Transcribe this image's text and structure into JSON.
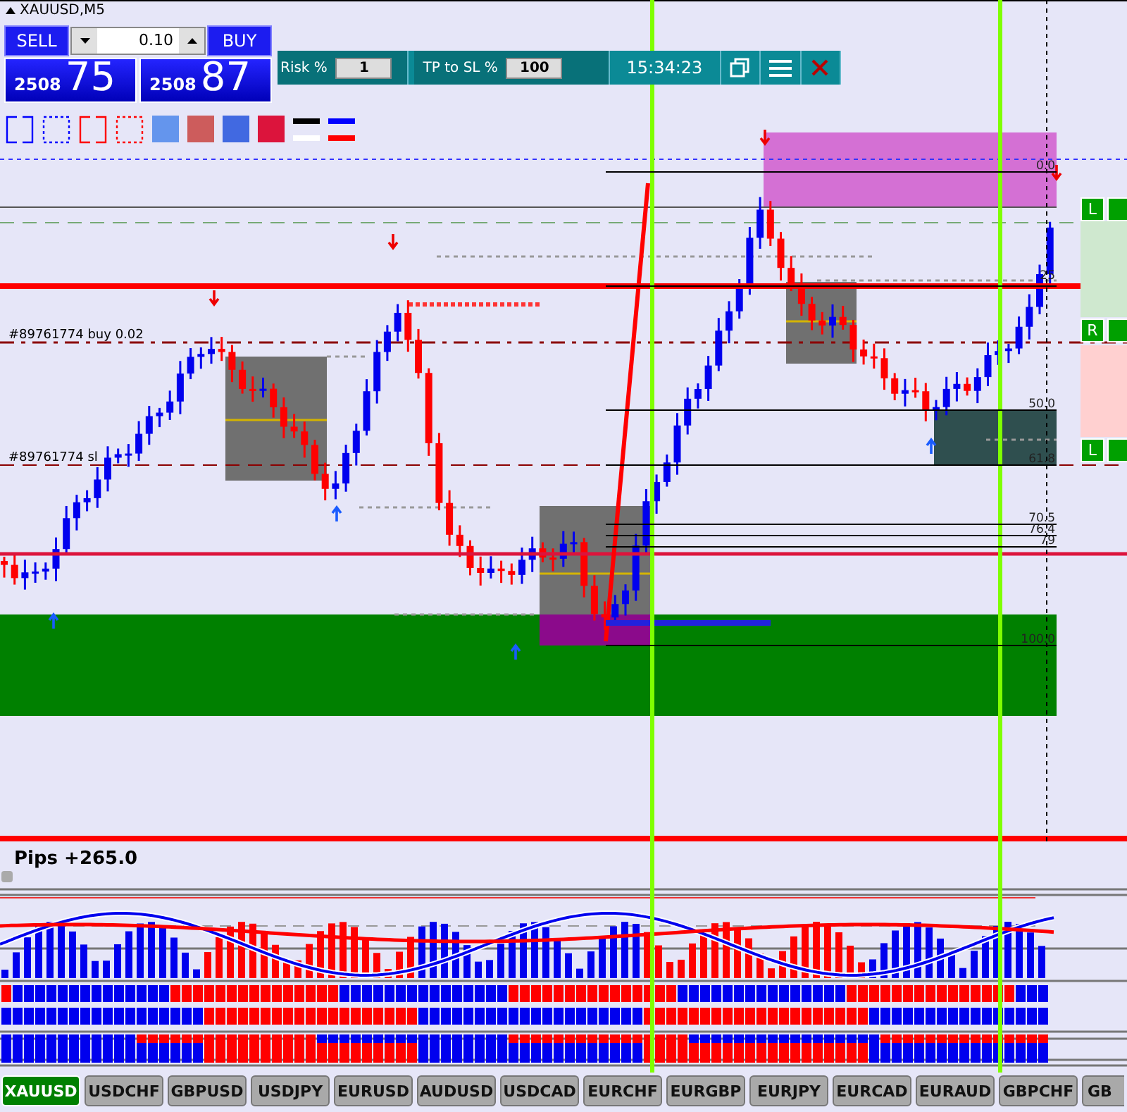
{
  "window": {
    "title": "XAUUSD,M5"
  },
  "trade_panel": {
    "sell": {
      "label": "SELL",
      "price_major": "2508",
      "price_minor": "75"
    },
    "lot": {
      "value": "0.10"
    },
    "buy": {
      "label": "BUY",
      "price_major": "2508",
      "price_minor": "87"
    },
    "risk": {
      "label": "Risk %",
      "value": "1"
    },
    "tp_to_sl": {
      "label": "TP to SL %",
      "value": "100"
    },
    "clock": "15:34:23"
  },
  "chart": {
    "order_labels": [
      "#89761774 buy 0.02",
      "#89761774 sl"
    ],
    "fib_levels": [
      "0.0",
      "25",
      "50.0",
      "61.8",
      "70.5",
      "76.4",
      "79",
      "100.0"
    ],
    "side_buttons": [
      "L",
      "R",
      "L"
    ]
  },
  "indicator": {
    "title": "Pips +265.0"
  },
  "tabs": [
    {
      "label": "XAUUSD",
      "selected": true
    },
    {
      "label": "USDCHF",
      "selected": false
    },
    {
      "label": "GBPUSD",
      "selected": false
    },
    {
      "label": "USDJPY",
      "selected": false
    },
    {
      "label": "EURUSD",
      "selected": false
    },
    {
      "label": "AUDUSD",
      "selected": false
    },
    {
      "label": "USDCAD",
      "selected": false
    },
    {
      "label": "EURCHF",
      "selected": false
    },
    {
      "label": "EURGBP",
      "selected": false
    },
    {
      "label": "EURJPY",
      "selected": false
    },
    {
      "label": "EURCAD",
      "selected": false
    },
    {
      "label": "EURAUD",
      "selected": false
    },
    {
      "label": "GBPCHF",
      "selected": false
    },
    {
      "label": "GB",
      "selected": false
    }
  ]
}
